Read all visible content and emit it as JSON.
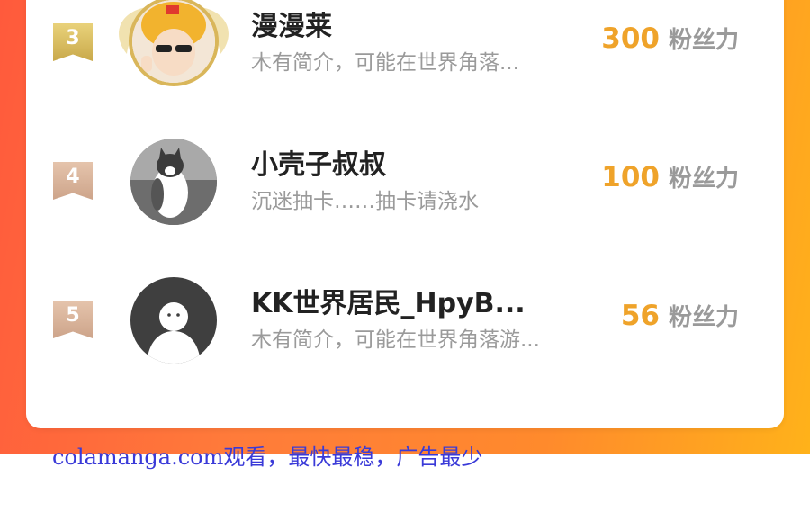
{
  "ranking": [
    {
      "rank": "3",
      "name": "漫漫莱",
      "bio": "木有简介，可能在世界角落...",
      "score": "300",
      "unit": "粉丝力",
      "badge_color": "#d4b858"
    },
    {
      "rank": "4",
      "name": "小壳子叔叔",
      "bio": "沉迷抽卡……抽卡请浇水",
      "score": "100",
      "unit": "粉丝力",
      "badge_color": "#d8b59c"
    },
    {
      "rank": "5",
      "name": "KK世界居民_HpyB...",
      "bio": "木有简介，可能在世界角落游...",
      "score": "56",
      "unit": "粉丝力",
      "badge_color": "#d8b59c"
    }
  ],
  "colors": {
    "accent": "#efa32a",
    "background_gradient_start": "#ff5a3c",
    "background_gradient_end": "#ffb21a"
  },
  "watermark": "colamanga.com观看，最快最稳，广告最少"
}
